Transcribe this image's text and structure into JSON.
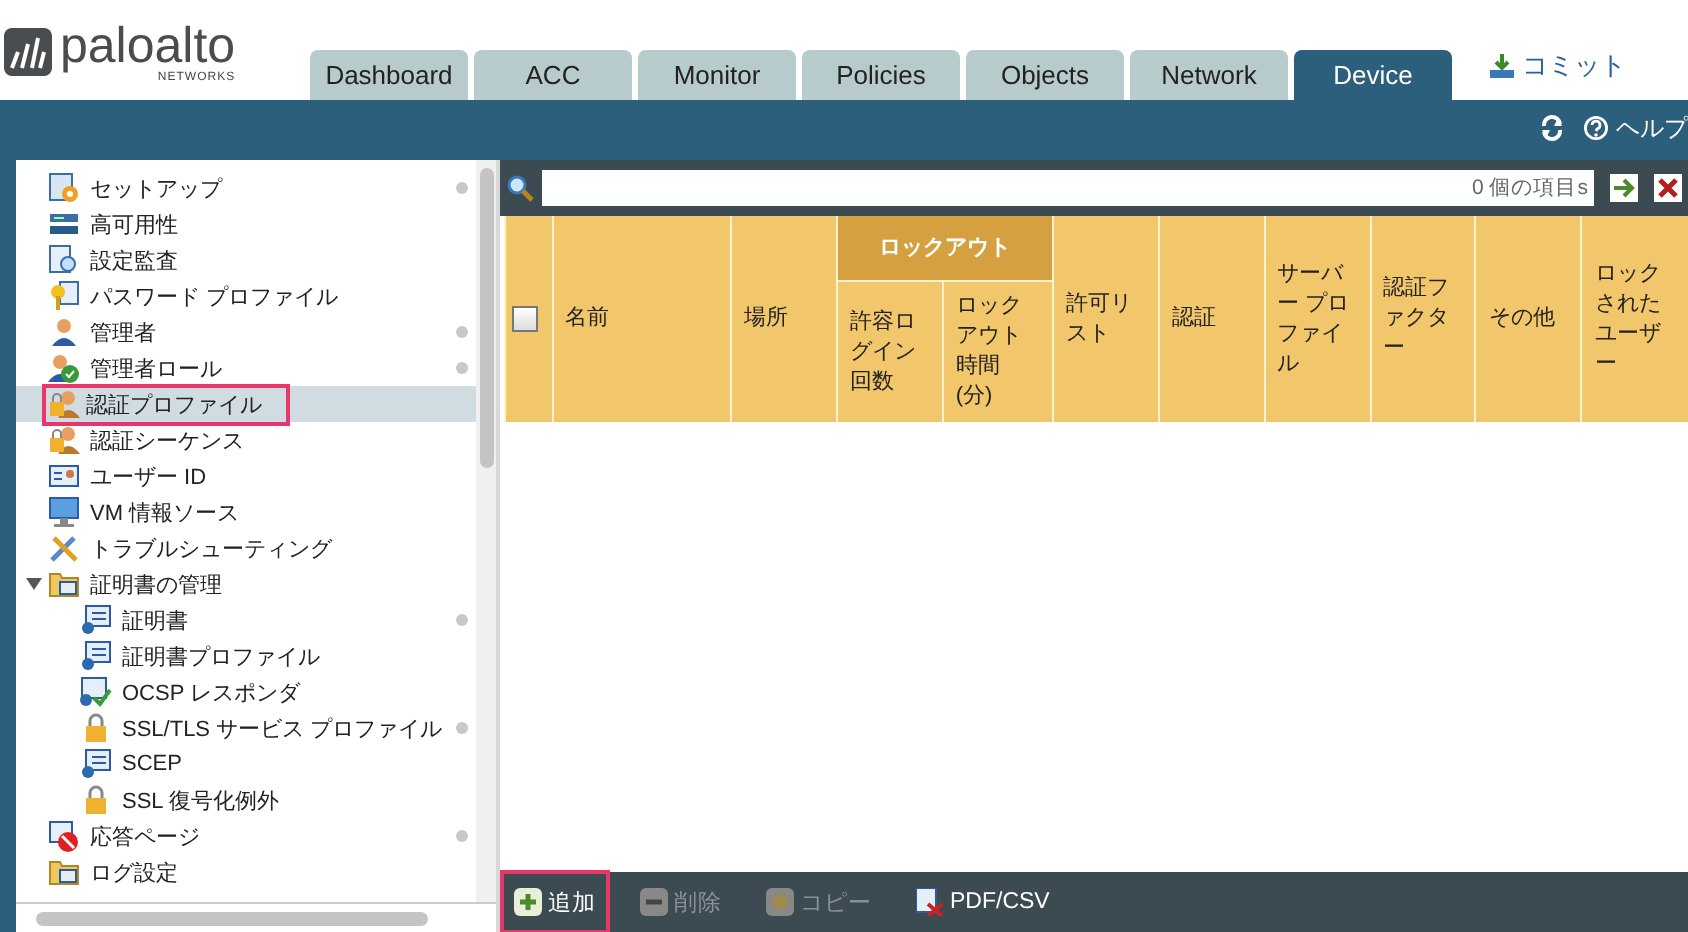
{
  "logo": {
    "name": "paloalto",
    "sub": "NETWORKS"
  },
  "tabs": [
    {
      "label": "Dashboard",
      "selected": false
    },
    {
      "label": "ACC",
      "selected": false
    },
    {
      "label": "Monitor",
      "selected": false
    },
    {
      "label": "Policies",
      "selected": false
    },
    {
      "label": "Objects",
      "selected": false
    },
    {
      "label": "Network",
      "selected": false
    },
    {
      "label": "Device",
      "selected": true
    }
  ],
  "commit": "コミット",
  "help": "ヘルプ",
  "sidebar": {
    "items": [
      {
        "label": "セットアップ",
        "kind": "gear",
        "dot": true,
        "selected": false,
        "highlighted": false
      },
      {
        "label": "高可用性",
        "kind": "server",
        "dot": false,
        "selected": false,
        "highlighted": false
      },
      {
        "label": "設定監査",
        "kind": "search",
        "dot": false,
        "selected": false,
        "highlighted": false
      },
      {
        "label": "パスワード プロファイル",
        "kind": "key",
        "dot": false,
        "selected": false,
        "highlighted": false
      },
      {
        "label": "管理者",
        "kind": "user",
        "dot": true,
        "selected": false,
        "highlighted": false
      },
      {
        "label": "管理者ロール",
        "kind": "user-check",
        "dot": true,
        "selected": false,
        "highlighted": false
      },
      {
        "label": "認証プロファイル",
        "kind": "user-lock",
        "dot": false,
        "selected": true,
        "highlighted": true
      },
      {
        "label": "認証シーケンス",
        "kind": "user-lock",
        "dot": false,
        "selected": false,
        "highlighted": false
      },
      {
        "label": "ユーザー ID",
        "kind": "id-card",
        "dot": false,
        "selected": false,
        "highlighted": false
      },
      {
        "label": "VM 情報ソース",
        "kind": "monitor",
        "dot": false,
        "selected": false,
        "highlighted": false
      },
      {
        "label": "トラブルシューティング",
        "kind": "tools",
        "dot": false,
        "selected": false,
        "highlighted": false
      },
      {
        "label": "証明書の管理",
        "kind": "folder",
        "dot": false,
        "selected": false,
        "highlighted": false,
        "expanded": true,
        "children": [
          {
            "label": "証明書",
            "kind": "cert",
            "dot": true,
            "selected": false,
            "highlighted": false
          },
          {
            "label": "証明書プロファイル",
            "kind": "cert",
            "dot": false,
            "selected": false,
            "highlighted": false
          },
          {
            "label": "OCSP レスポンダ",
            "kind": "cert-check",
            "dot": false,
            "selected": false,
            "highlighted": false
          },
          {
            "label": "SSL/TLS サービス プロファイル",
            "kind": "lock",
            "dot": true,
            "selected": false,
            "highlighted": false
          },
          {
            "label": "SCEP",
            "kind": "cert",
            "dot": false,
            "selected": false,
            "highlighted": false
          },
          {
            "label": "SSL 復号化例外",
            "kind": "lock",
            "dot": false,
            "selected": false,
            "highlighted": false
          }
        ]
      },
      {
        "label": "応答ページ",
        "kind": "no-entry",
        "dot": true,
        "selected": false,
        "highlighted": false
      },
      {
        "label": "ログ設定",
        "kind": "folder",
        "dot": false,
        "selected": false,
        "highlighted": false
      }
    ]
  },
  "search": {
    "count": "0 個の項目s"
  },
  "select_all": {
    "checked": false
  },
  "table": {
    "group": "ロックアウト",
    "columns": [
      {
        "label": "名前",
        "group": false
      },
      {
        "label": "場所",
        "group": false
      },
      {
        "label": "許容ログイン回数",
        "group": true
      },
      {
        "label": "ロックアウト時間 (分)",
        "group": true
      },
      {
        "label": "許可リスト",
        "group": false
      },
      {
        "label": "認証",
        "group": false
      },
      {
        "label": "サーバー プロファイル",
        "group": false
      },
      {
        "label": "認証ファクター",
        "group": false
      },
      {
        "label": "その他",
        "group": false
      },
      {
        "label": "ロックされたユーザー",
        "group": false
      }
    ]
  },
  "footer": [
    {
      "label": "追加",
      "kind": "plus",
      "disabled": false,
      "highlighted": true
    },
    {
      "label": "削除",
      "kind": "minus",
      "disabled": true,
      "highlighted": false
    },
    {
      "label": "コピー",
      "kind": "copy",
      "disabled": true,
      "highlighted": false
    },
    {
      "label": "PDF/CSV",
      "kind": "pdf",
      "disabled": false,
      "highlighted": false
    }
  ]
}
